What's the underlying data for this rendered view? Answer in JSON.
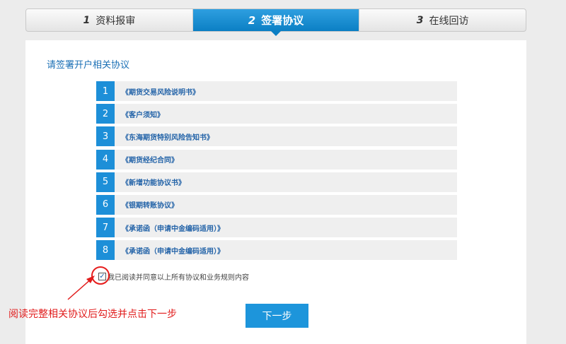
{
  "steps": [
    {
      "num": "1",
      "label": "资料报审"
    },
    {
      "num": "2",
      "label": "签署协议"
    },
    {
      "num": "3",
      "label": "在线回访"
    }
  ],
  "title": "请签署开户相关协议",
  "agreements": [
    {
      "idx": "1",
      "name": "《期货交易风险说明书》"
    },
    {
      "idx": "2",
      "name": "《客户须知》"
    },
    {
      "idx": "3",
      "name": "《东海期货特别风险告知书》"
    },
    {
      "idx": "4",
      "name": "《期货经纪合同》"
    },
    {
      "idx": "5",
      "name": "《新增功能协议书》"
    },
    {
      "idx": "6",
      "name": "《银期转账协议》"
    },
    {
      "idx": "7",
      "name": "《承诺函（申请中金编码适用）》"
    },
    {
      "idx": "8",
      "name": "《承诺函（申请中金编码适用）》"
    }
  ],
  "consent": {
    "checked": true,
    "check_glyph": "✓",
    "label": "我已阅读并同意以上所有协议和业务规则内容"
  },
  "next_button": "下一步",
  "annotation": "阅读完整相关协议后勾选并点击下一步",
  "colors": {
    "accent": "#1d8fd8",
    "annotation": "#e11c1c"
  }
}
